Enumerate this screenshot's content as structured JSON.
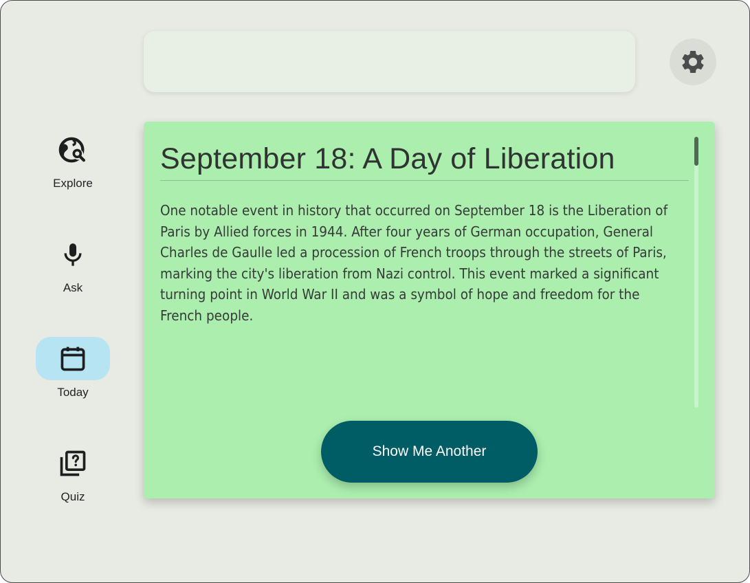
{
  "nav": {
    "items": [
      {
        "label": "Explore",
        "icon": "travel-explore-icon",
        "active": false
      },
      {
        "label": "Ask",
        "icon": "microphone-icon",
        "active": false
      },
      {
        "label": "Today",
        "icon": "calendar-icon",
        "active": true
      },
      {
        "label": "Quiz",
        "icon": "quiz-icon",
        "active": false
      }
    ]
  },
  "header": {
    "search_value": "",
    "settings_icon": "gear-icon"
  },
  "card": {
    "title": "September 18: A Day of Liberation",
    "body": "One notable event in history that occurred on September 18 is the Liberation of Paris by Allied forces in  1944. After four years of German occupation, General Charles de Gaulle led a procession of French troops through the streets of Paris, marking the city's liberation from Nazi control. This event marked a significant turning point in World War II and was a symbol of hope and freedom for the French people.",
    "button_label": "Show Me Another"
  },
  "colors": {
    "background": "#e8eae4",
    "card": "#abeeae",
    "active_nav": "#b7e4f2",
    "button": "#005c65"
  }
}
